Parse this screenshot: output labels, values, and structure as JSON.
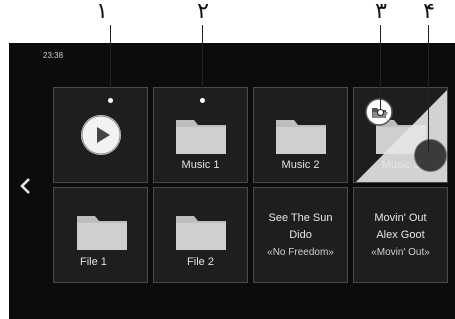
{
  "callouts": [
    "١",
    "٢",
    "٣",
    "۴"
  ],
  "status": {
    "time": "23:38"
  },
  "nav": {
    "back_icon": "chevron-left-icon"
  },
  "tiles": {
    "play": {
      "icon": "play-icon"
    },
    "music1": {
      "label": "Music 1"
    },
    "music2": {
      "label": "Music 2"
    },
    "music3": {
      "label": "Music 3",
      "overlay_icon": "open-folder-icon"
    },
    "file1": {
      "label": "File 1"
    },
    "file2": {
      "label": "File 2"
    },
    "song1": {
      "title": "See The Sun",
      "artist": "Dido",
      "album": "«No Freedom»"
    },
    "song2": {
      "title": "Movin' Out",
      "artist": "Alex Goot",
      "album": "«Movin' Out»"
    }
  },
  "colors": {
    "screen_bg": "#0c0c0c",
    "tile_bg": "#1e1e1e",
    "tile_border": "#4a4a4a",
    "folder": "#bdbdbd"
  }
}
